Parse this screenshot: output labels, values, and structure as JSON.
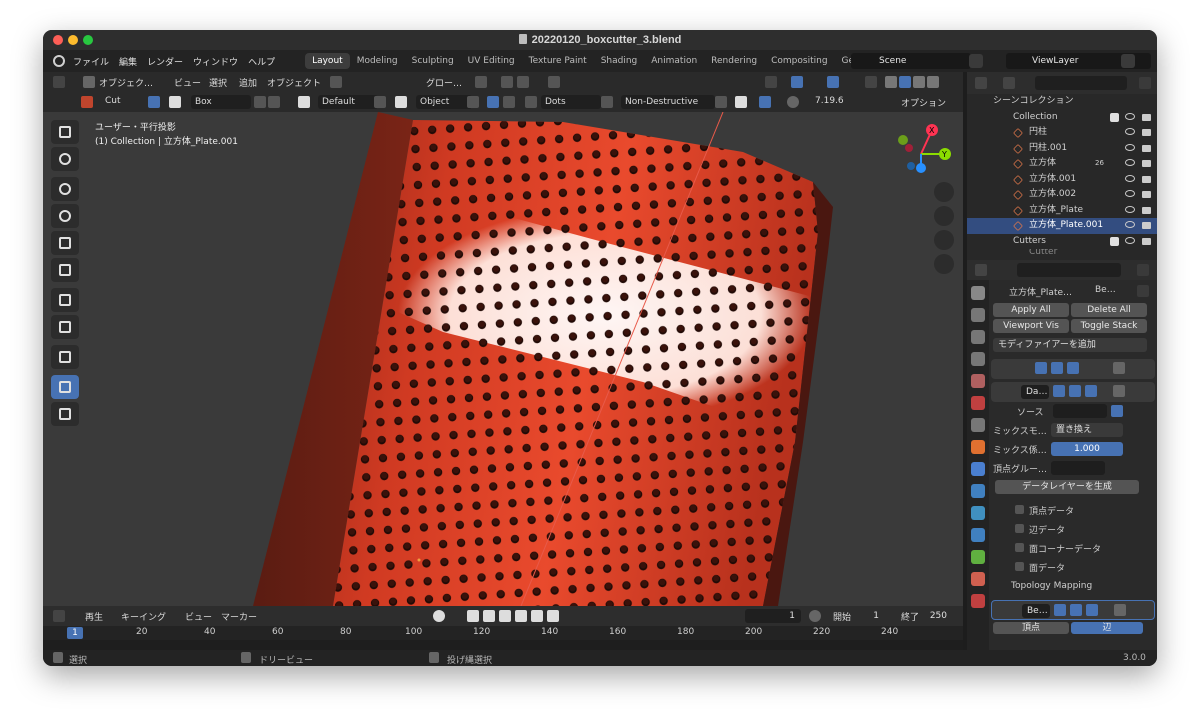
{
  "window": {
    "title": "20220120_boxcutter_3.blend"
  },
  "menu": [
    "ファイル",
    "編集",
    "レンダー",
    "ウィンドウ",
    "ヘルプ"
  ],
  "workspaces": [
    {
      "label": "Layout",
      "active": true
    },
    {
      "label": "Modeling"
    },
    {
      "label": "Sculpting"
    },
    {
      "label": "UV Editing"
    },
    {
      "label": "Texture Paint"
    },
    {
      "label": "Shading"
    },
    {
      "label": "Animation"
    },
    {
      "label": "Rendering"
    },
    {
      "label": "Compositing"
    },
    {
      "label": "Geometry"
    }
  ],
  "scene": "Scene",
  "view_layer": "ViewLayer",
  "header1": {
    "mode": "オブジェク…",
    "view": "ビュー",
    "select": "選択",
    "add": "追加",
    "object": "オブジェクト",
    "transform": "グロー…"
  },
  "header2": {
    "shape": "Cut",
    "box": "Box",
    "default": "Default",
    "object": "Object",
    "dots": "Dots",
    "destructive": "Non-Destructive",
    "version": "7.19.6",
    "options": "オプション"
  },
  "viewport": {
    "view_label": "ユーザー・平行投影",
    "collection_label": "(1) Collection | 立方体_Plate.001",
    "axis_x": "X",
    "axis_y": "Y",
    "axis_z": "Z"
  },
  "outliner": {
    "root": "シーンコレクション",
    "collection": "Collection",
    "items": [
      {
        "name": "円柱"
      },
      {
        "name": "円柱.001"
      },
      {
        "name": "立方体"
      },
      {
        "name": "立方体.001"
      },
      {
        "name": "立方体.002"
      },
      {
        "name": "立方体_Plate"
      },
      {
        "name": "立方体_Plate.001",
        "selected": true
      }
    ],
    "cutters": "Cutters",
    "cutter_item": "Cutter",
    "vertex_count_badge": "26"
  },
  "properties": {
    "breadcrumb_obj": "立方体_Plate…",
    "breadcrumb_mod": "Be…",
    "apply_all": "Apply All",
    "delete_all": "Delete All",
    "viewport_vis": "Viewport Vis",
    "toggle_stack": "Toggle Stack",
    "add_modifier": "モディファイアーを追加",
    "mod2_name": "Da…",
    "source_label": "ソース",
    "mix_mode_label": "ミックスモ…",
    "mix_mode_value": "置き換え",
    "mix_factor_label": "ミックス係…",
    "mix_factor_value": "1.000",
    "vgroup_label": "頂点グルー…",
    "generate_button": "データレイヤーを生成",
    "subpanels": [
      "頂点データ",
      "辺データ",
      "面コーナーデータ",
      "面データ"
    ],
    "topology": "Topology Mapping",
    "mod3_name": "Be…",
    "bottom_tab_vertex": "頂点",
    "bottom_tab_edge": "辺"
  },
  "timeline": {
    "playback": "再生",
    "keying": "キーイング",
    "view": "ビュー",
    "marker": "マーカー",
    "current_frame": "1",
    "start_label": "開始",
    "start_value": "1",
    "end_label": "終了",
    "end_value": "250",
    "ruler_cur": "1",
    "ticks": [
      "20",
      "40",
      "60",
      "80",
      "100",
      "120",
      "140",
      "160",
      "180",
      "200",
      "220",
      "240"
    ]
  },
  "status": {
    "select": "選択",
    "drag_preview": "ドリービュー",
    "lasso": "投げ縄選択",
    "version": "3.0.0"
  },
  "colors": {
    "accent": "#4772b3",
    "object_red": "#e8422a",
    "background": "#3a3a3a"
  }
}
